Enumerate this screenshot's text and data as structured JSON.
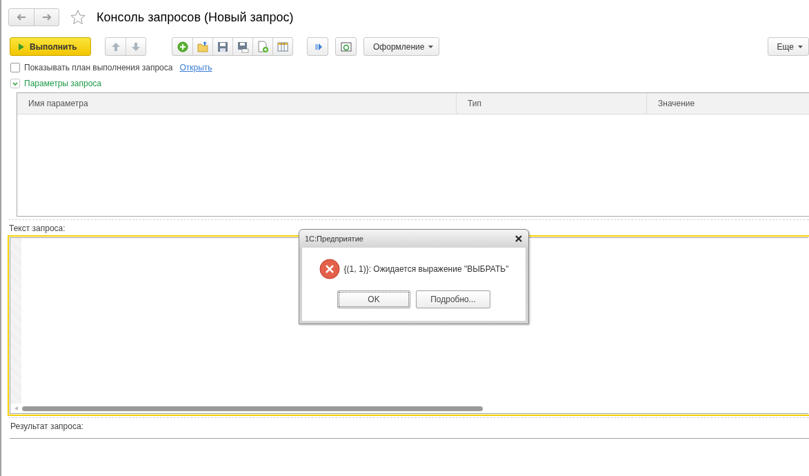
{
  "window": {
    "title": "Консоль запросов (Новый запрос)",
    "favorite": false
  },
  "toolbar": {
    "run_button": "Выполнить",
    "design_menu": "Оформление",
    "more_menu": "Еще"
  },
  "plan_option": {
    "label": "Показывать план выполнения запроса",
    "checked": false,
    "link": "Открыть"
  },
  "parameters_section": {
    "title": "Параметры запроса",
    "expanded": true
  },
  "parameters_table": {
    "columns": [
      "Имя параметра",
      "Тип",
      "Значение"
    ]
  },
  "query_text": {
    "label": "Текст запроса:"
  },
  "query_result": {
    "label": "Результат запроса:"
  },
  "dialog": {
    "title": "1С:Предприятие",
    "message": "{(1, 1)}: Ожидается выражение \"ВЫБРАТЬ\"",
    "buttons": [
      {
        "label": "OK",
        "focused": true
      },
      {
        "label": "Подробно...",
        "focused": false
      }
    ]
  }
}
